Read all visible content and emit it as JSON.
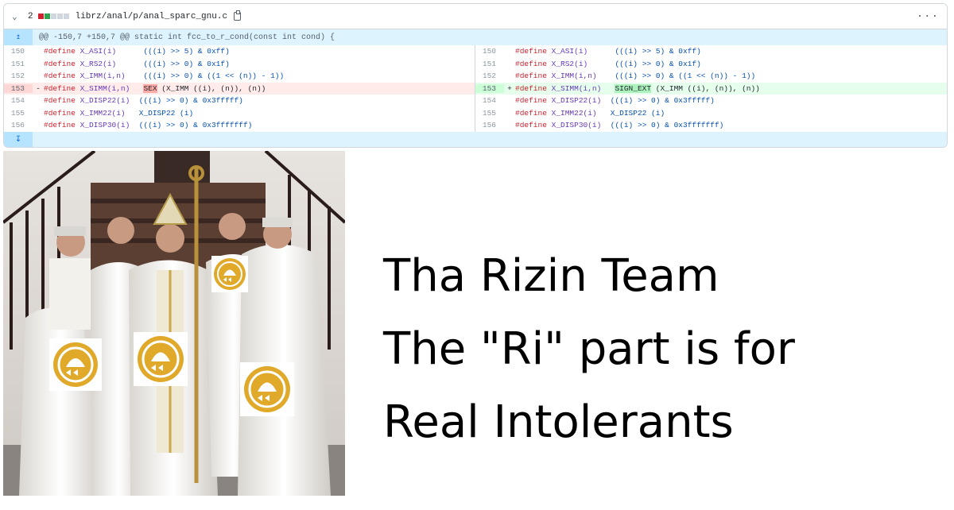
{
  "diff": {
    "file_count": "2",
    "file_path": "librz/anal/p/anal_sparc_gnu.c",
    "hunk_header": "@@ -150,7 +150,7 @@ static int fcc_to_r_cond(const int cond) {",
    "left": [
      {
        "n": "150",
        "sign": "",
        "pre": "#define",
        "name": "X_ASI(i)",
        "pad": "      ",
        "body": "(((i) >> 5) & 0xff)"
      },
      {
        "n": "151",
        "sign": "",
        "pre": "#define",
        "name": "X_RS2(i)",
        "pad": "      ",
        "body": "(((i) >> 0) & 0x1f)"
      },
      {
        "n": "152",
        "sign": "",
        "pre": "#define",
        "name": "X_IMM(i,n)",
        "pad": "    ",
        "body": "(((i) >> 0) & ((1 << (n)) - 1))"
      },
      {
        "n": "153",
        "sign": "-",
        "pre": "#define",
        "name": "X_SIMM(i,n)",
        "pad": "   ",
        "hl": "SEX",
        "body": " (X_IMM ((i), (n)), (n))"
      },
      {
        "n": "154",
        "sign": "",
        "pre": "#define",
        "name": "X_DISP22(i)",
        "pad": "  ",
        "body": "(((i) >> 0) & 0x3fffff)"
      },
      {
        "n": "155",
        "sign": "",
        "pre": "#define",
        "name": "X_IMM22(i)",
        "pad": "   ",
        "body": "X_DISP22 (i)"
      },
      {
        "n": "156",
        "sign": "",
        "pre": "#define",
        "name": "X_DISP30(i)",
        "pad": "  ",
        "body": "(((i) >> 0) & 0x3fffffff)"
      }
    ],
    "right": [
      {
        "n": "150",
        "sign": "",
        "pre": "#define",
        "name": "X_ASI(i)",
        "pad": "      ",
        "body": "(((i) >> 5) & 0xff)"
      },
      {
        "n": "151",
        "sign": "",
        "pre": "#define",
        "name": "X_RS2(i)",
        "pad": "      ",
        "body": "(((i) >> 0) & 0x1f)"
      },
      {
        "n": "152",
        "sign": "",
        "pre": "#define",
        "name": "X_IMM(i,n)",
        "pad": "    ",
        "body": "(((i) >> 0) & ((1 << (n)) - 1))"
      },
      {
        "n": "153",
        "sign": "+",
        "pre": "#define",
        "name": "X_SIMM(i,n)",
        "pad": "   ",
        "hl": "SIGN_EXT",
        "body": " (X_IMM ((i), (n)), (n))"
      },
      {
        "n": "154",
        "sign": "",
        "pre": "#define",
        "name": "X_DISP22(i)",
        "pad": "  ",
        "body": "(((i) >> 0) & 0x3fffff)"
      },
      {
        "n": "155",
        "sign": "",
        "pre": "#define",
        "name": "X_IMM22(i)",
        "pad": "   ",
        "body": "X_DISP22 (i)"
      },
      {
        "n": "156",
        "sign": "",
        "pre": "#define",
        "name": "X_DISP30(i)",
        "pad": "  ",
        "body": "(((i) >> 0) & 0x3fffffff)"
      }
    ]
  },
  "caption": {
    "line1": "Tha Rizin Team",
    "line2": "The \"Ri\" part is for",
    "line3": "Real Intolerants"
  },
  "colors": {
    "logo_gold": "#e0a92a",
    "diff_deleted": "#ffebe9",
    "diff_added": "#e6ffec",
    "hunk_blue": "#ddf4ff"
  },
  "icons": [
    "chevron-down-icon",
    "copy-icon",
    "kebab-menu-icon",
    "expand-up-icon",
    "expand-down-icon",
    "rizin-logo-icon"
  ]
}
